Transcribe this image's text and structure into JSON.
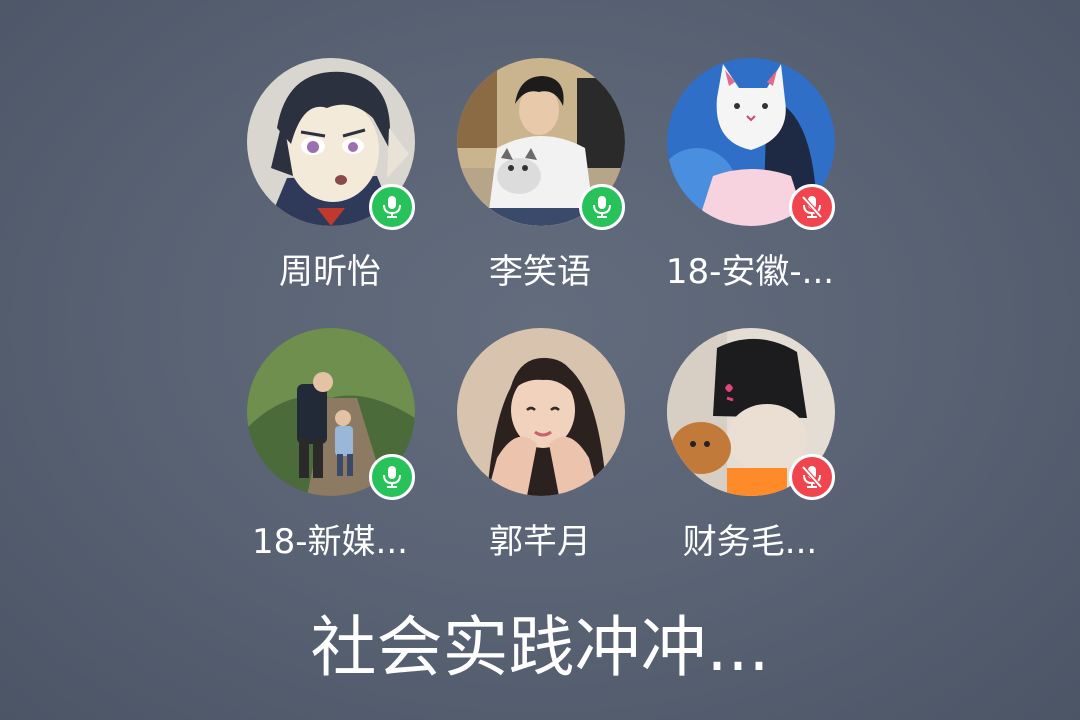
{
  "members": [
    {
      "name": "周昕怡",
      "mic": "on",
      "avatar": "anime-boy-avatar-icon"
    },
    {
      "name": "李笑语",
      "mic": "on",
      "avatar": "man-with-cat-avatar-icon"
    },
    {
      "name": "18-安徽-...",
      "mic": "off",
      "avatar": "cat-mask-girl-avatar-icon"
    },
    {
      "name": "18-新媒...",
      "mic": "on",
      "avatar": "father-child-avatar-icon"
    },
    {
      "name": "郭芊月",
      "mic": "none",
      "avatar": "girl-selfie-avatar-icon"
    },
    {
      "name": "财务毛...",
      "mic": "off",
      "avatar": "beanie-dog-avatar-icon"
    }
  ],
  "room": {
    "title": "社会实践冲冲..."
  },
  "colors": {
    "mic_on": "#27c25a",
    "mic_off": "#f0454e",
    "background": "#5a6475"
  }
}
